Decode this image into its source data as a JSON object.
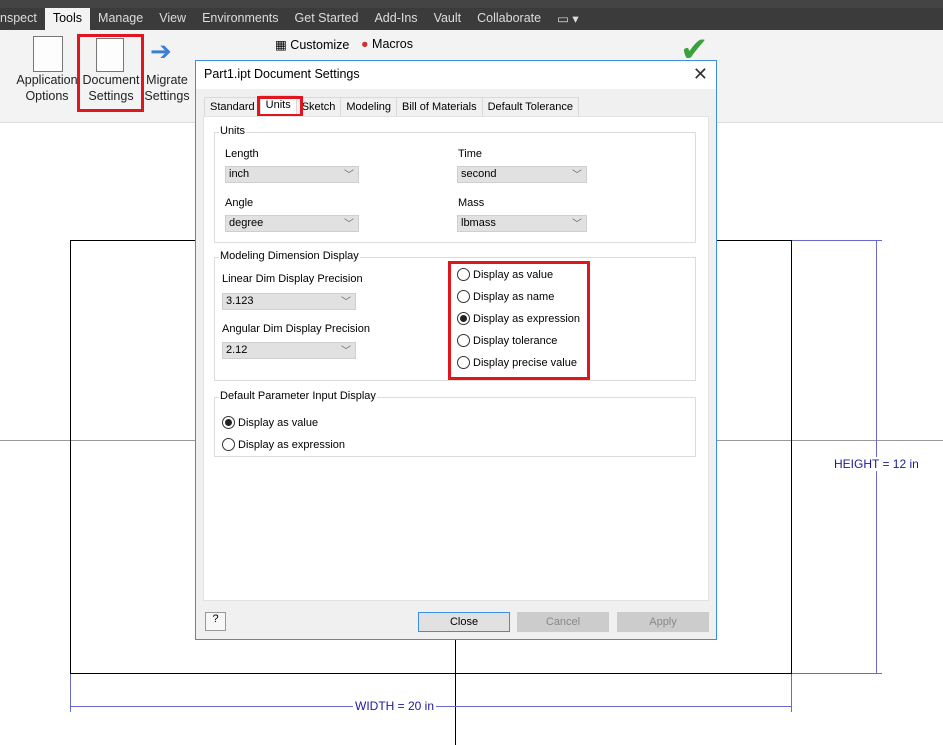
{
  "ribbon": {
    "tabs": [
      "nspect",
      "Tools",
      "Manage",
      "View",
      "Environments",
      "Get Started",
      "Add-Ins",
      "Vault",
      "Collaborate"
    ],
    "active_tab": "Tools",
    "buttons": {
      "app_options": [
        "Application",
        "Options"
      ],
      "doc_settings": [
        "Document",
        "Settings"
      ],
      "migrate": [
        "Migrate",
        "Settings"
      ],
      "customize": "Customize",
      "macros": "Macros"
    }
  },
  "dialog": {
    "title": "Part1.ipt Document Settings",
    "tabs": [
      "Standard",
      "Units",
      "Sketch",
      "Modeling",
      "Bill of Materials",
      "Default Tolerance"
    ],
    "active_tab": "Units",
    "units": {
      "group": "Units",
      "length_label": "Length",
      "length_value": "inch",
      "time_label": "Time",
      "time_value": "second",
      "angle_label": "Angle",
      "angle_value": "degree",
      "mass_label": "Mass",
      "mass_value": "lbmass"
    },
    "modeling": {
      "group": "Modeling Dimension Display",
      "linear_label": "Linear Dim Display Precision",
      "linear_value": "3.123",
      "angular_label": "Angular Dim Display Precision",
      "angular_value": "2.12",
      "options": [
        "Display as value",
        "Display as name",
        "Display as expression",
        "Display tolerance",
        "Display precise value"
      ],
      "selected": "Display as expression"
    },
    "param": {
      "group": "Default Parameter Input Display",
      "options": [
        "Display as value",
        "Display as expression"
      ],
      "selected": "Display as value"
    },
    "buttons": {
      "close": "Close",
      "cancel": "Cancel",
      "apply": "Apply"
    }
  },
  "drawing": {
    "height_dim": "HEIGHT = 12 in",
    "width_dim": "WIDTH = 20 in"
  },
  "colors": {
    "highlight": "#e0151d",
    "dimension": "#1a1a9a",
    "accent": "#3c8ee0"
  }
}
